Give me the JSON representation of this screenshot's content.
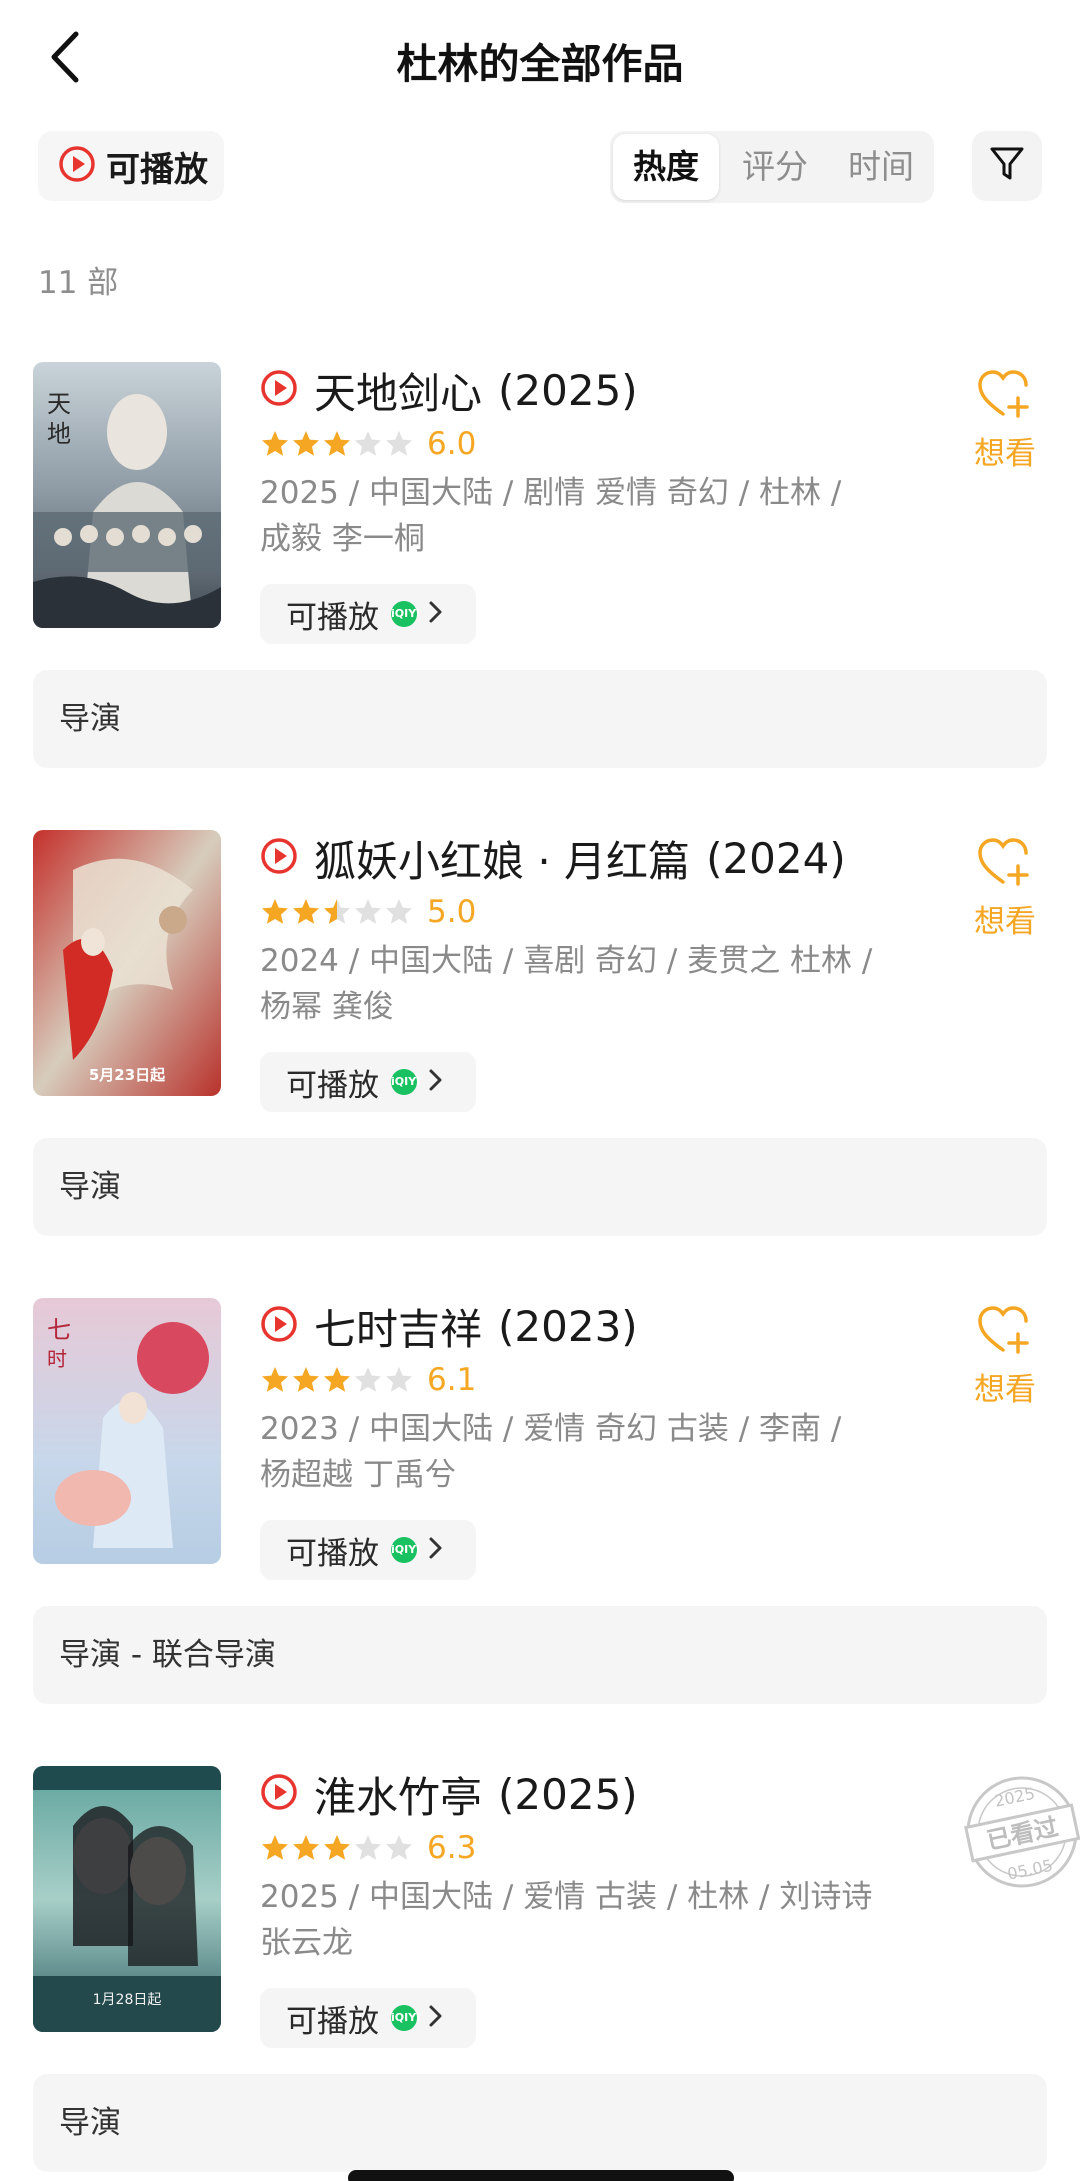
{
  "nav": {
    "back_icon": "chevron-left-icon",
    "title": "杜林的全部作品"
  },
  "filters": {
    "playable_label": "可播放",
    "sort_options": [
      "热度",
      "评分",
      "时间"
    ],
    "sort_active": "热度",
    "filter_icon": "funnel-icon"
  },
  "count_label": "11 部",
  "colors": {
    "accent_orange": "#f5a623",
    "play_red": "#e8342e",
    "iqiyi_green": "#19c160",
    "star_gray": "#e0e0e0"
  },
  "works": [
    {
      "title": "天地剑心",
      "year": "(2025)",
      "rating": "6.0",
      "stars": 3,
      "meta_line1": "2025 / 中国大陆 / 剧情 爱情 奇幻 / 杜林 /",
      "meta_line2": "成毅 李一桐",
      "play_label": "可播放",
      "platform_badge": "iQIYI",
      "action_label": "想看",
      "role": "导演",
      "watched": false
    },
    {
      "title": "狐妖小红娘 · 月红篇",
      "year": "(2024)",
      "rating": "5.0",
      "stars": 2.5,
      "meta_line1": "2024 / 中国大陆 / 喜剧 奇幻 / 麦贯之 杜林 /",
      "meta_line2": "杨幂 龚俊",
      "play_label": "可播放",
      "platform_badge": "iQIYI",
      "action_label": "想看",
      "role": "导演",
      "poster_caption": "5月23日起",
      "watched": false
    },
    {
      "title": "七时吉祥",
      "year": "(2023)",
      "rating": "6.1",
      "stars": 3,
      "meta_line1": "2023 / 中国大陆 / 爱情 奇幻 古装 / 李南 /",
      "meta_line2": "杨超越 丁禹兮",
      "play_label": "可播放",
      "platform_badge": "iQIYI",
      "action_label": "想看",
      "role": "导演 - 联合导演",
      "watched": false
    },
    {
      "title": "淮水竹亭",
      "year": "(2025)",
      "rating": "6.3",
      "stars": 3,
      "meta_line1": "2025 / 中国大陆 / 爱情 古装 / 杜林 / 刘诗诗",
      "meta_line2": "张云龙",
      "play_label": "可播放",
      "platform_badge": "iQIYI",
      "action_label": "",
      "role": "导演",
      "poster_caption": "1月28日起",
      "watched": true,
      "stamp_year": "2025",
      "stamp_text": "已看过",
      "stamp_date": "05.05"
    }
  ]
}
